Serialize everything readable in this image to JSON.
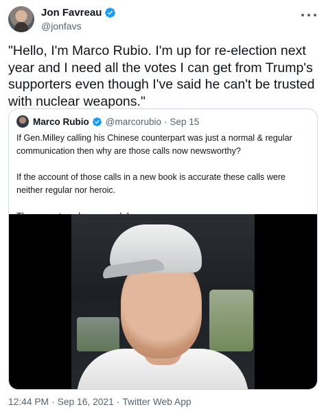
{
  "author": {
    "display_name": "Jon Favreau",
    "handle": "@jonfavs",
    "verified": true
  },
  "tweet": {
    "text": "\"Hello, I'm Marco Rubio. I'm up for re-election next year and I need all the votes I can get from Trump's supporters even though I've said he can't be trusted with nuclear weapons.\""
  },
  "quoted_tweet": {
    "display_name": "Marco Rubio",
    "handle": "@marcorubio",
    "separator": "·",
    "date": "Sep 15",
    "paragraphs": [
      "If Gen.Milley calling his Chinese counterpart was just a normal & regular communication then why are those calls now newsworthy?",
      "If the account of those calls in a new book is accurate these calls were neither regular nor heroic.",
      "They were treacherous and dangerous."
    ]
  },
  "footer": {
    "time": "12:44 PM",
    "separator": "·",
    "date": "Sep 16, 2021",
    "source": "Twitter Web App"
  },
  "icons": {
    "verified": "verified-badge-icon",
    "more": "more-options-icon"
  },
  "colors": {
    "verified_blue": "#1d9bf0",
    "secondary_text": "#536471",
    "border": "#cfd9de"
  }
}
